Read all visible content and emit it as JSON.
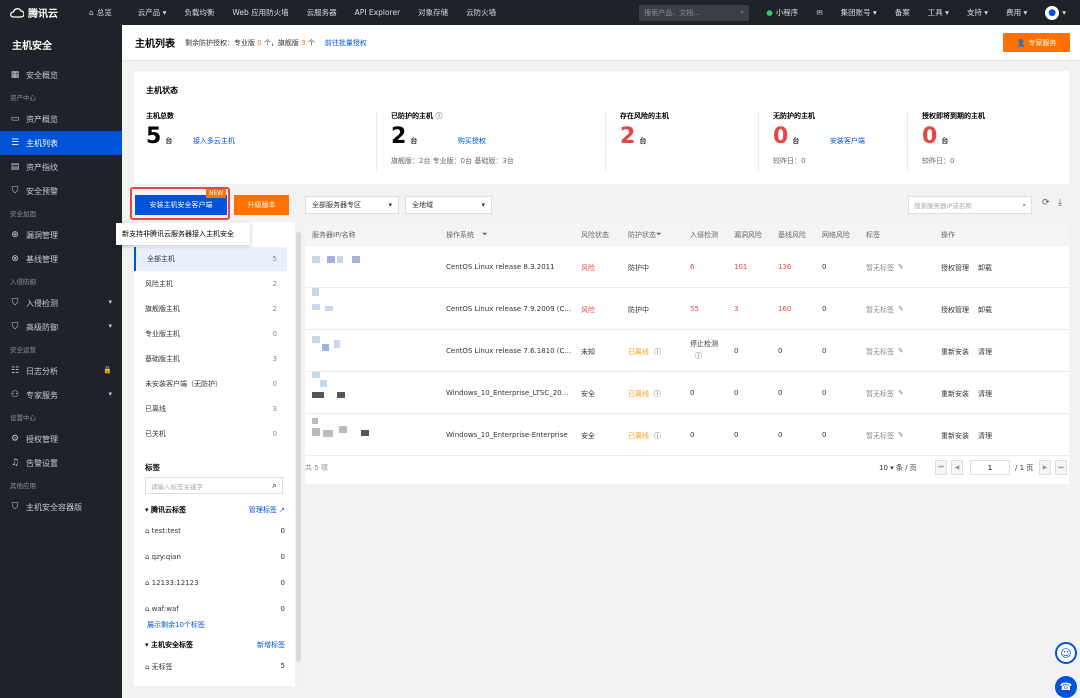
{
  "topbar": {
    "logo": "腾讯云",
    "overview": "总览",
    "nav": [
      "云产品 ▾",
      "负载均衡",
      "Web 应用防火墙",
      "云服务器",
      "API Explorer",
      "对象存储",
      "云防火墙"
    ],
    "search_placeholder": "搜索产品、文档...",
    "right": [
      "小程序",
      "集团账号 ▾",
      "备案",
      "工具 ▾",
      "支持 ▾",
      "费用 ▾"
    ]
  },
  "sidebar": {
    "title": "主机安全",
    "groups": [
      {
        "label": "",
        "items": [
          {
            "label": "安全概览",
            "icon": "dashboard-icon"
          }
        ]
      },
      {
        "label": "资产中心",
        "items": [
          {
            "label": "资产概览",
            "icon": "monitor-icon"
          },
          {
            "label": "主机列表",
            "icon": "server-icon",
            "active": true
          },
          {
            "label": "资产指纹",
            "icon": "fingerprint-icon"
          },
          {
            "label": "安全预警",
            "icon": "shield-icon"
          }
        ]
      },
      {
        "label": "安全加固",
        "items": [
          {
            "label": "漏洞管理",
            "icon": "bug-icon"
          },
          {
            "label": "基线管理",
            "icon": "baseline-icon"
          }
        ]
      },
      {
        "label": "入侵防御",
        "items": [
          {
            "label": "入侵检测",
            "icon": "shield-icon",
            "chev": true
          },
          {
            "label": "高级防御",
            "icon": "shield-icon",
            "chev": true
          }
        ]
      },
      {
        "label": "安全运营",
        "items": [
          {
            "label": "日志分析",
            "icon": "log-icon",
            "lock": true
          },
          {
            "label": "专家服务",
            "icon": "expert-icon",
            "chev": true
          }
        ]
      },
      {
        "label": "设置中心",
        "items": [
          {
            "label": "授权管理",
            "icon": "license-icon"
          },
          {
            "label": "告警设置",
            "icon": "bell-icon"
          }
        ]
      },
      {
        "label": "其他应用",
        "items": [
          {
            "label": "主机安全容器版",
            "icon": "shield-icon"
          }
        ]
      }
    ]
  },
  "header": {
    "title": "主机列表",
    "quota_prefix": "剩余防护授权：专业版",
    "quota_pro": "0",
    "quota_mid": "个，旗舰版",
    "quota_flag": "3",
    "quota_suffix": "个",
    "batch_link": "前往批量授权",
    "expert_button": "专家服务"
  },
  "status": {
    "title": "主机状态",
    "total": {
      "label": "主机总数",
      "value": "5",
      "unit": "台",
      "link": "接入多云主机"
    },
    "protected": {
      "label": "已防护的主机",
      "value": "2",
      "unit": "台",
      "link": "购买授权",
      "sub": "旗舰版：2台    专业版：0台    基础版：3台"
    },
    "risk": {
      "label": "存在风险的主机",
      "value": "2",
      "unit": "台"
    },
    "unprotected": {
      "label": "无防护的主机",
      "value": "0",
      "unit": "台",
      "link": "安装客户端",
      "sub": "较昨日：0"
    },
    "expiring": {
      "label": "授权即将到期的主机",
      "value": "0",
      "unit": "台",
      "sub": "较昨日：0"
    }
  },
  "toolbar": {
    "install_button": "安装主机安全客户端",
    "new_badge": "NEW",
    "upgrade_button": "升级版本",
    "tooltip": "新支持非腾讯云服务器接入主机安全",
    "zone_select": "全部服务器专区",
    "region_select": "全地域",
    "search_placeholder": "搜索服务器IP或名称"
  },
  "filters": [
    {
      "label": "全部主机",
      "count": "5",
      "active": true
    },
    {
      "label": "风险主机",
      "count": "2"
    },
    {
      "label": "旗舰版主机",
      "count": "2"
    },
    {
      "label": "专业版主机",
      "count": "0"
    },
    {
      "label": "基础版主机",
      "count": "3"
    },
    {
      "label": "未安装客户端（无防护）",
      "count": "0"
    },
    {
      "label": "已离线",
      "count": "3"
    },
    {
      "label": "已关机",
      "count": "0"
    }
  ],
  "tags": {
    "title": "标签",
    "search_placeholder": "请输入标签关键字",
    "cloud_group": "腾讯云标签",
    "manage": "管理标签",
    "cloud_tags": [
      {
        "label": "test:test",
        "count": "0"
      },
      {
        "label": "qzy:qian",
        "count": "0"
      },
      {
        "label": "12133:12123",
        "count": "0"
      },
      {
        "label": "waf:waf",
        "count": "0"
      }
    ],
    "more": "展示剩余10个标签",
    "host_group": "主机安全标签",
    "add": "新增标签",
    "host_tags": [
      {
        "label": "无标签",
        "count": "5"
      }
    ]
  },
  "table": {
    "columns": [
      "服务器IP/名称",
      "操作系统",
      "风险状态",
      "防护状态",
      "入侵检测",
      "漏洞风险",
      "基线风险",
      "网络风险",
      "标签",
      "操作"
    ],
    "rows": [
      {
        "os": "CentOS Linux release 8.3.2011",
        "risk": "风险",
        "risk_color": "red",
        "protect": "防护中",
        "intrusion": "6",
        "vuln": "101",
        "baseline": "136",
        "network": "0",
        "tag": "暂无标签",
        "ops": [
          "授权管理",
          "卸载"
        ]
      },
      {
        "os": "CentOS Linux release 7.9.2009 (C...",
        "risk": "风险",
        "risk_color": "red",
        "protect": "防护中",
        "intrusion": "55",
        "vuln": "3",
        "baseline": "160",
        "network": "0",
        "tag": "暂无标签",
        "ops": [
          "授权管理",
          "卸载"
        ]
      },
      {
        "os": "CentOS Linux release 7.6.1810 (C...",
        "risk": "未知",
        "protect": "已离线",
        "offline": true,
        "intrusion": "停止检测",
        "vuln": "0",
        "baseline": "0",
        "network": "0",
        "tag": "暂无标签",
        "ops": [
          "重新安装",
          "清理"
        ]
      },
      {
        "os": "Windows_10_Enterprise_LTSC_20...",
        "risk": "安全",
        "protect": "已离线",
        "offline": true,
        "intrusion": "0",
        "vuln": "0",
        "baseline": "0",
        "network": "0",
        "tag": "暂无标签",
        "ops": [
          "重新安装",
          "清理"
        ]
      },
      {
        "os": "Windows_10_Enterprise-Enterprise",
        "risk": "安全",
        "protect": "已离线",
        "offline": true,
        "intrusion": "0",
        "vuln": "0",
        "baseline": "0",
        "network": "0",
        "tag": "暂无标签",
        "ops": [
          "重新安装",
          "清理"
        ]
      }
    ]
  },
  "pager": {
    "total": "共 5 项",
    "size": "10 ▾ 条 / 页",
    "page": "1",
    "pages": "/ 1 页"
  }
}
